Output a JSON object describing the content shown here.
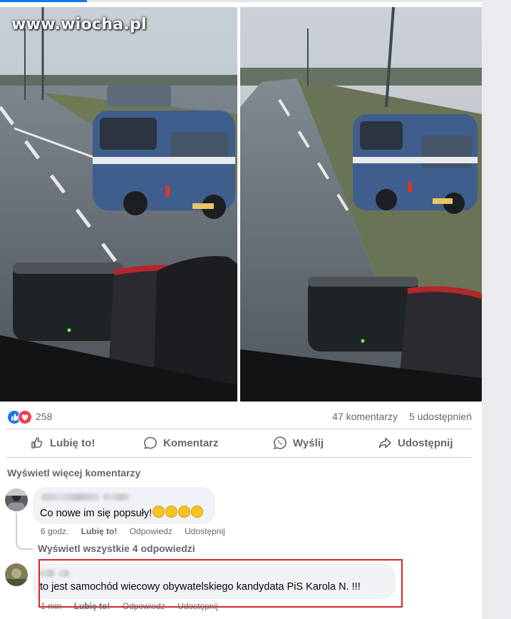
{
  "watermark": "www.wiocha.pl",
  "reactions": {
    "count": "258",
    "comments": "47 komentarzy",
    "shares": "5 udostępnień"
  },
  "actions": {
    "like": "Lubię to!",
    "comment": "Komentarz",
    "send": "Wyślij",
    "share": "Udostępnij"
  },
  "more_comments": "Wyświetl więcej komentarzy",
  "comments": [
    {
      "text": "Co nowe im się popsuły!",
      "time": "6 godz.",
      "like": "Lubię to!",
      "reply": "Odpowiedz",
      "share": "Udostępnij"
    },
    {
      "text": "to jest samochód wiecowy obywatelskiego kandydata PiS Karola N. !!!",
      "time": "1 min",
      "like": "Lubię to!",
      "reply": "Odpowiedz",
      "share": "Udostępnij"
    }
  ],
  "replies_link": "Wyświetl wszystkie 4 odpowiedzi",
  "colors": {
    "accent": "#1877f2",
    "love": "#f33e58",
    "highlight": "#d9222a",
    "muted": "#65676b"
  }
}
